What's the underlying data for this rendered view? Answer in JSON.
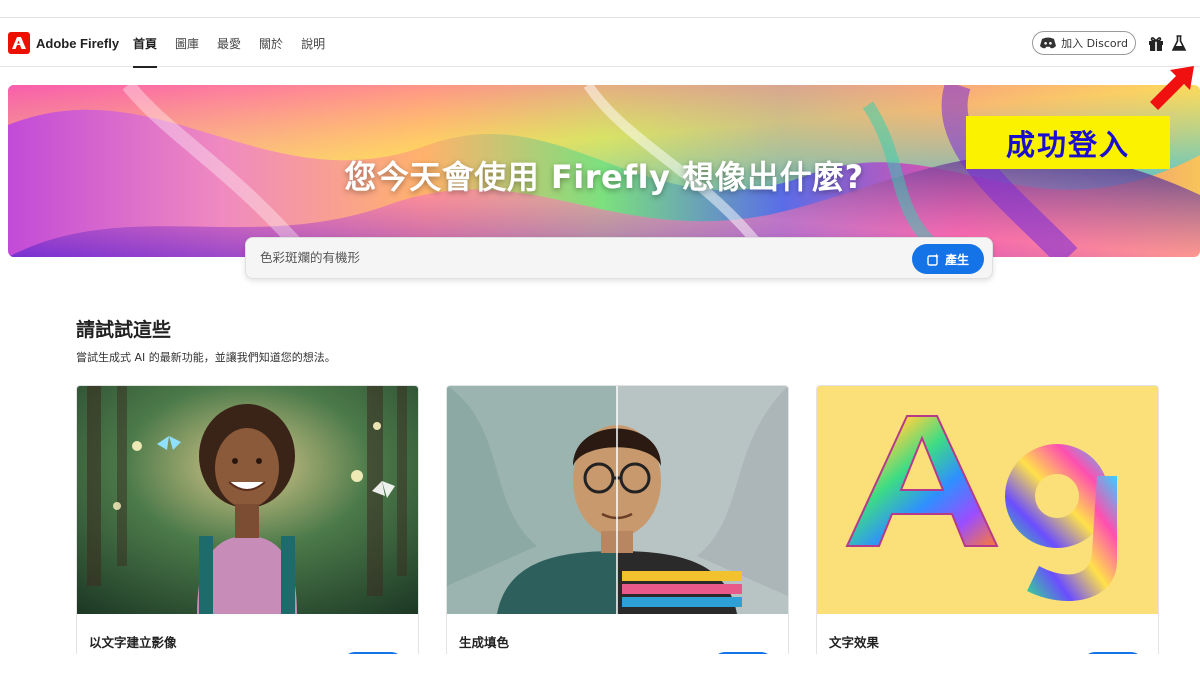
{
  "app": {
    "brand": "Adobe Firefly",
    "logo_icon": "adobe-logo-icon",
    "accent": "#eb1000",
    "primary": "#1473e6"
  },
  "nav": {
    "items": [
      {
        "label": "首頁",
        "active": true
      },
      {
        "label": "圖庫",
        "active": false
      },
      {
        "label": "最愛",
        "active": false
      },
      {
        "label": "關於",
        "active": false
      },
      {
        "label": "說明",
        "active": false
      }
    ]
  },
  "header": {
    "discord_label": "加入 Discord",
    "icons": [
      "discord-icon",
      "gift-icon",
      "flask-icon"
    ]
  },
  "hero": {
    "title": "您今天會使用 Firefly 想像出什麼?"
  },
  "prompt": {
    "value": "色彩斑斕的有機形",
    "generate_label": "產生"
  },
  "callout": {
    "text": "成功登入",
    "background": "#fbf200",
    "color": "#1a0ecf"
  },
  "section": {
    "title": "請試試這些",
    "subtitle": "嘗試生成式 AI 的最新功能，並讓我們知道您的想法。"
  },
  "cards": [
    {
      "title": "以文字建立影像",
      "image": "girl-with-butterflies"
    },
    {
      "title": "生成填色",
      "image": "man-portrait-split"
    },
    {
      "title": "文字效果",
      "image": "furry-rainbow-ag-letters"
    }
  ]
}
